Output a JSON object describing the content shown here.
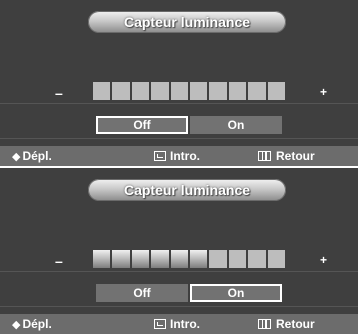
{
  "screens": [
    {
      "title": "Capteur luminance",
      "minus": "–",
      "plus": "+",
      "level": {
        "filled": 0,
        "total": 10
      },
      "options": {
        "off": "Off",
        "on": "On",
        "selected": "off"
      },
      "footer": {
        "move": "Dépl.",
        "enter": "Intro.",
        "return": "Retour",
        "move_icon": "◆"
      }
    },
    {
      "title": "Capteur luminance",
      "minus": "–",
      "plus": "+",
      "level": {
        "filled": 6,
        "total": 10
      },
      "options": {
        "off": "Off",
        "on": "On",
        "selected": "on"
      },
      "footer": {
        "move": "Dépl.",
        "enter": "Intro.",
        "return": "Retour",
        "move_icon": "◆"
      }
    }
  ],
  "colors": {
    "panel_bg": "#3f3f3f",
    "footer_bg": "#6c6c6c",
    "option_bg": "#727272",
    "text": "#ffffff"
  }
}
